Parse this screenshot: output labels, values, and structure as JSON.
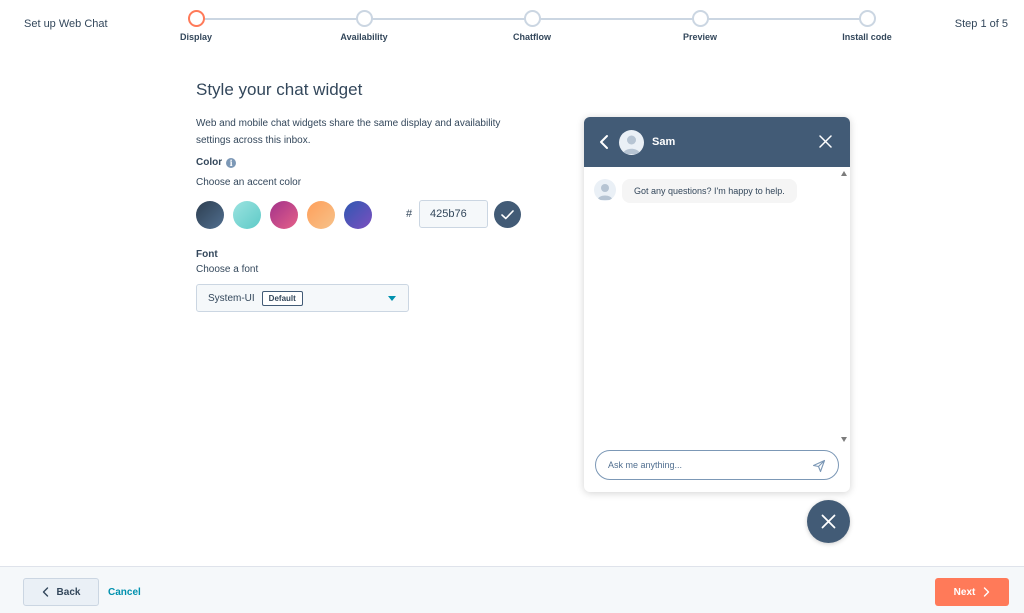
{
  "header": {
    "app_title": "Set up Web Chat",
    "step_count": "Step 1 of 5",
    "steps": [
      {
        "label": "Display",
        "active": true
      },
      {
        "label": "Availability",
        "active": false
      },
      {
        "label": "Chatflow",
        "active": false
      },
      {
        "label": "Preview",
        "active": false
      },
      {
        "label": "Install code",
        "active": false
      }
    ]
  },
  "form": {
    "title": "Style your chat widget",
    "description": "Web and mobile chat widgets share the same display and availability settings across this inbox.",
    "color": {
      "label": "Color",
      "hint": "Choose an accent color",
      "swatches": [
        {
          "from": "#2d3e50",
          "to": "#516f90"
        },
        {
          "from": "#9be3e0",
          "to": "#5ecac7"
        },
        {
          "from": "#a2328a",
          "to": "#e66189"
        },
        {
          "from": "#ff9f5a",
          "to": "#f6c28a"
        },
        {
          "from": "#2f58b2",
          "to": "#7c4fbf"
        }
      ],
      "hash": "#",
      "hex_value": "425b76",
      "selected_color": "#425b76"
    },
    "font": {
      "label": "Font",
      "hint": "Choose a font",
      "value": "System-UI",
      "badge": "Default"
    }
  },
  "widget": {
    "agent_name": "Sam",
    "message": "Got any questions? I'm happy to help.",
    "input_placeholder": "Ask me anything...",
    "header_color": "#425b76"
  },
  "footer": {
    "back_label": "Back",
    "cancel_label": "Cancel",
    "next_label": "Next"
  }
}
